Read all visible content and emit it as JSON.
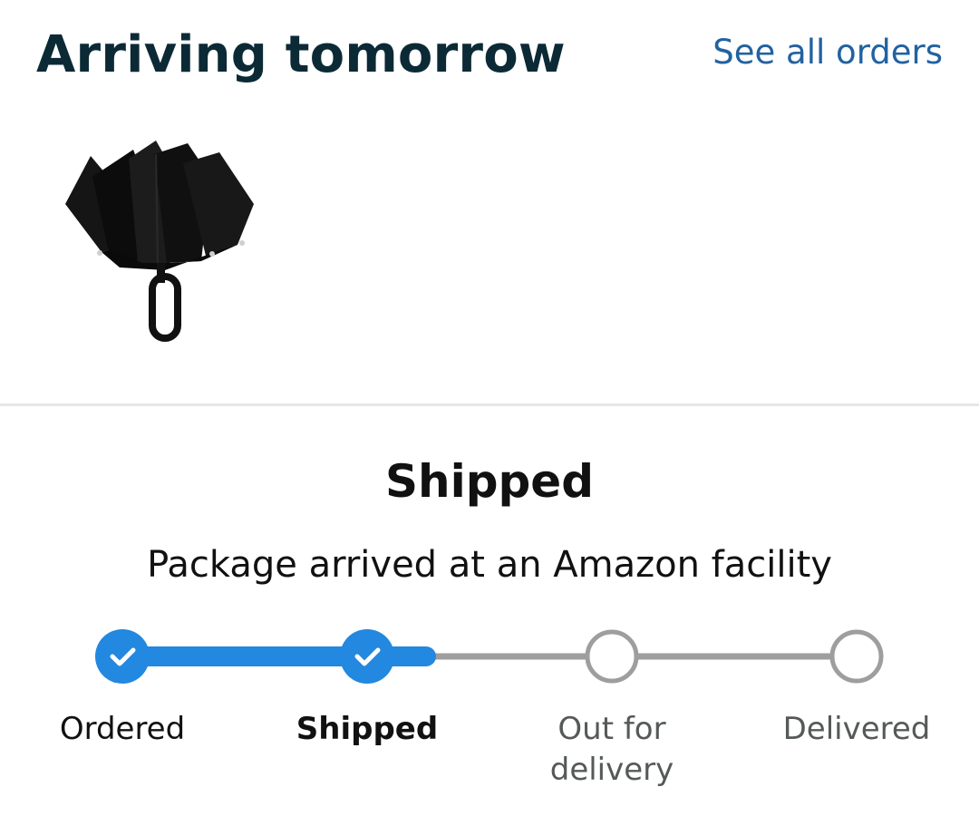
{
  "header": {
    "title": "Arriving tomorrow",
    "see_all_link": "See all orders"
  },
  "product": {
    "image_icon": "umbrella-icon"
  },
  "status": {
    "title": "Shipped",
    "subtitle": "Package arrived at an Amazon facility"
  },
  "progress": {
    "steps": [
      {
        "label": "Ordered",
        "state": "complete"
      },
      {
        "label": "Shipped",
        "state": "current"
      },
      {
        "label": "Out for delivery",
        "state": "future"
      },
      {
        "label": "Delivered",
        "state": "future"
      }
    ],
    "colors": {
      "complete": "#2288e0",
      "future": "#9e9e9e"
    }
  }
}
